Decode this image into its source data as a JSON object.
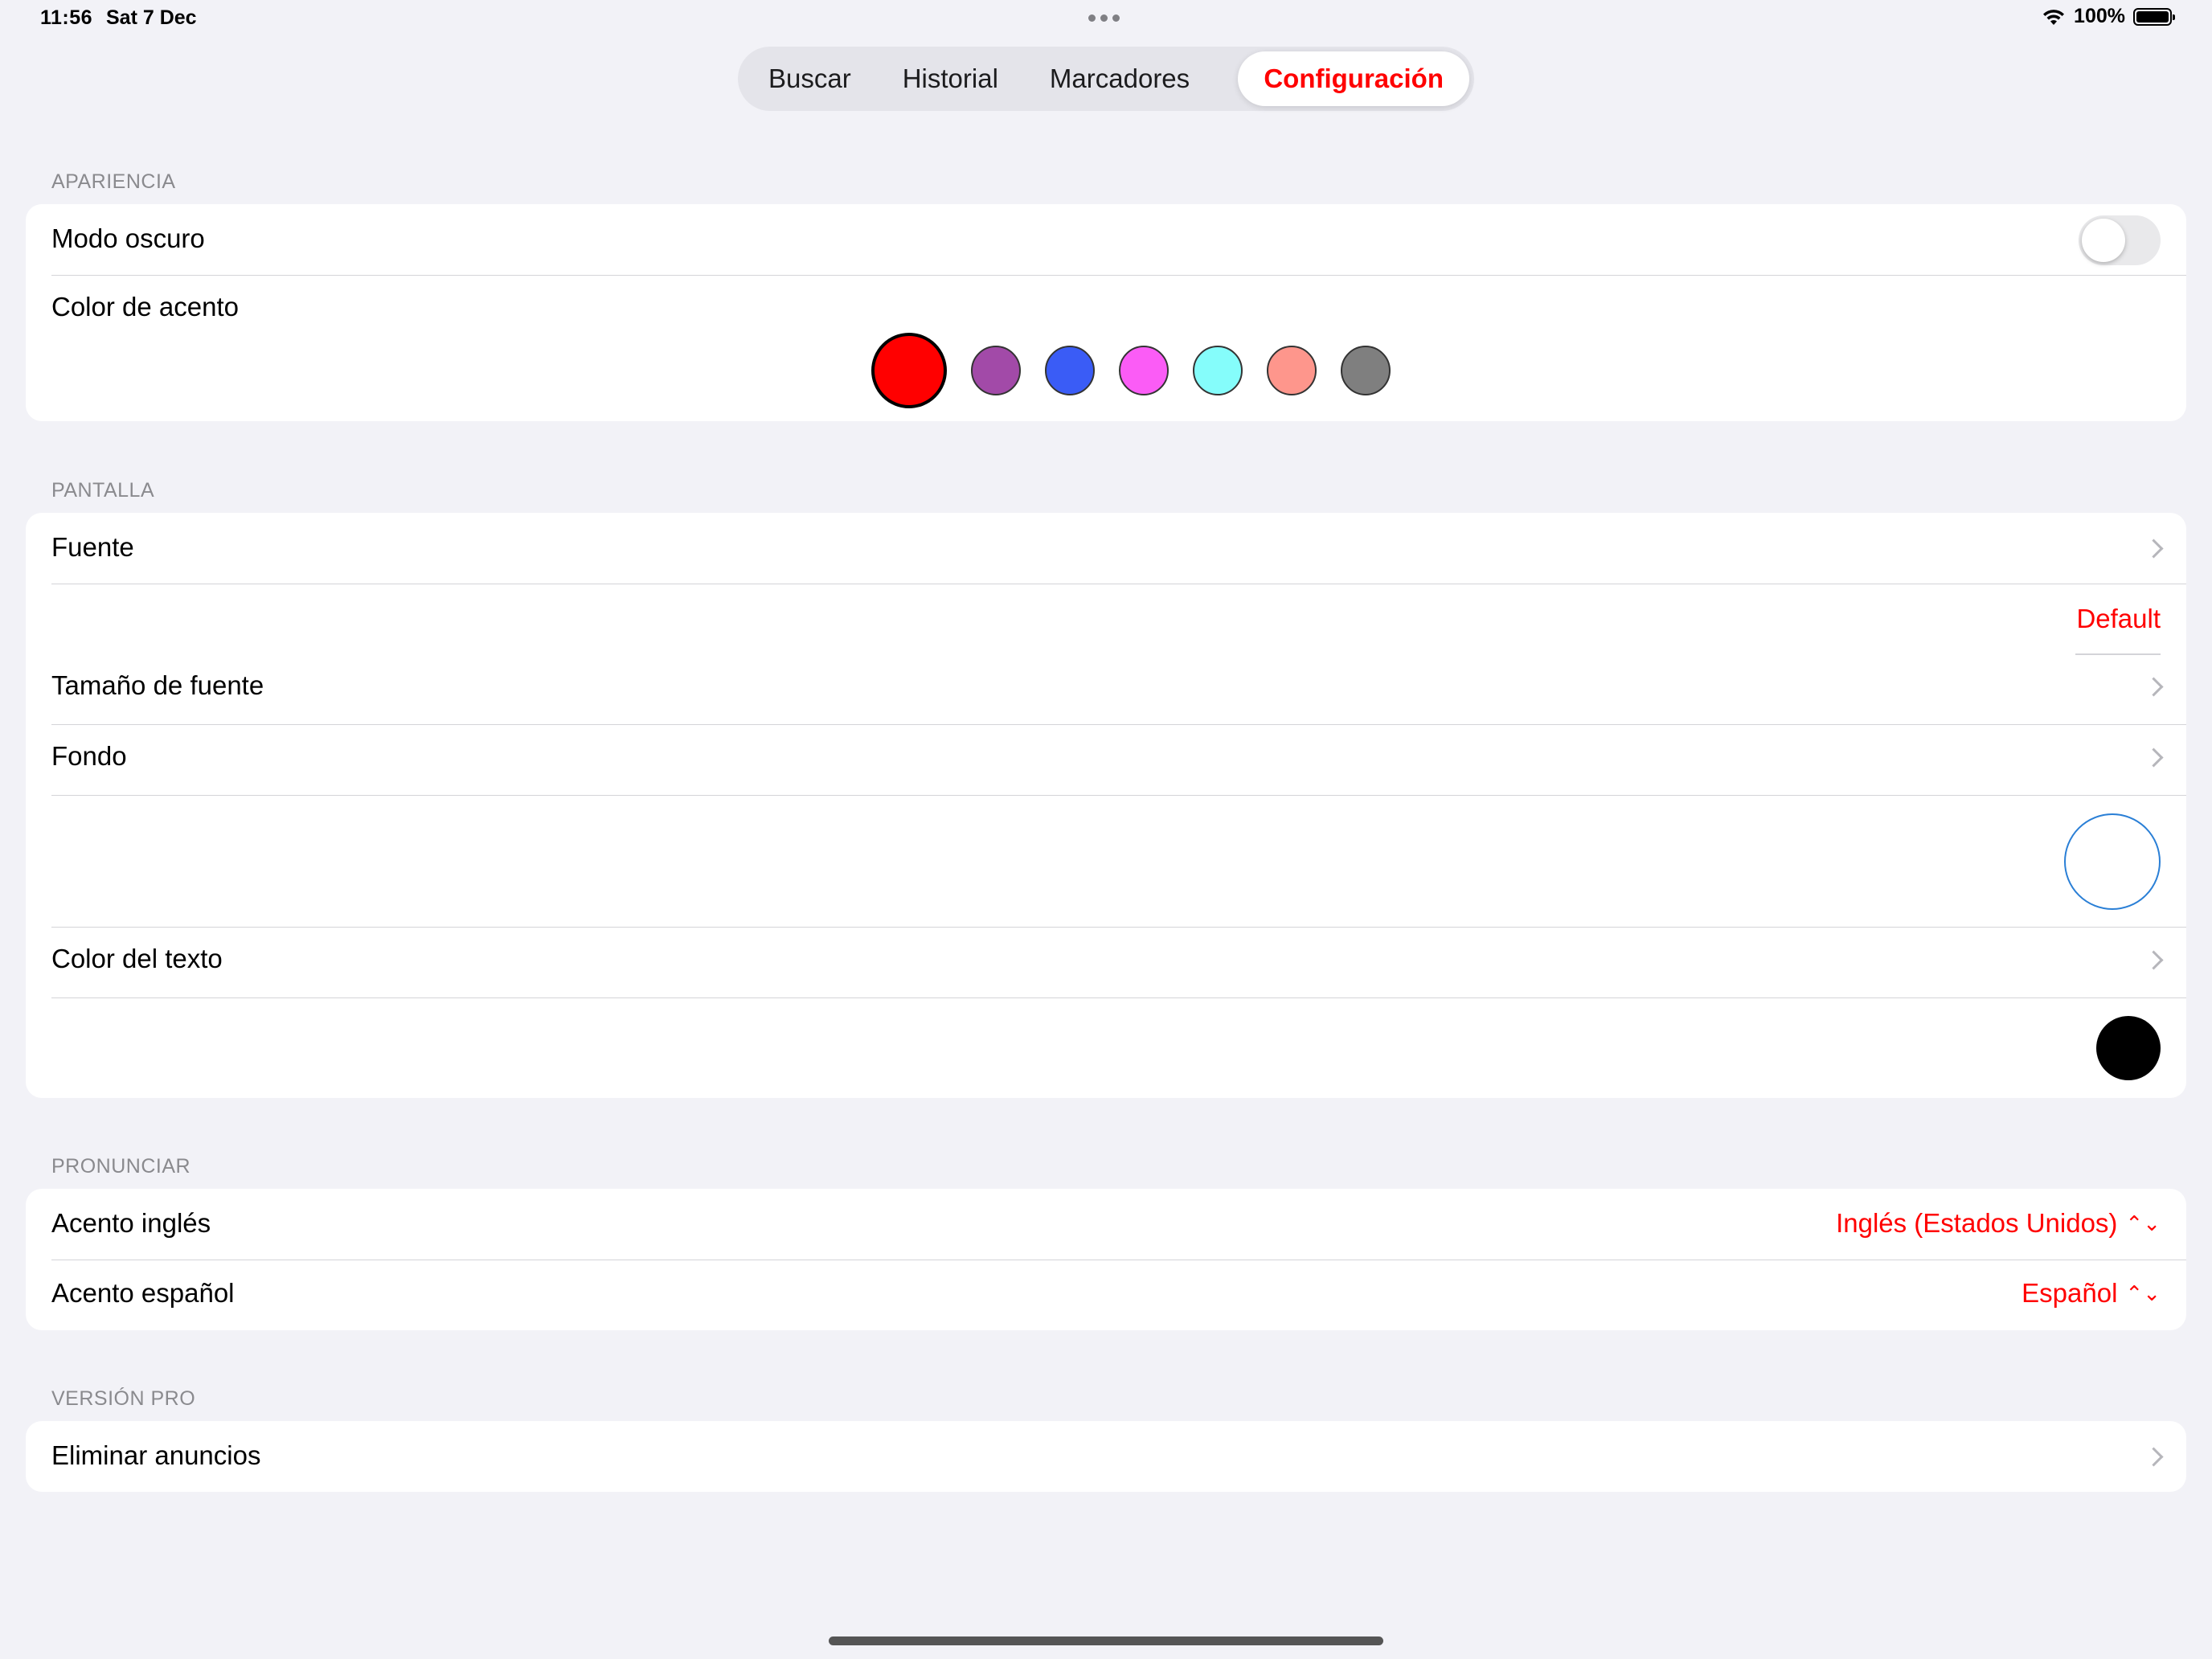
{
  "status_bar": {
    "time": "11:56",
    "date": "Sat 7 Dec",
    "battery": "100%"
  },
  "tabs": [
    {
      "label": "Buscar"
    },
    {
      "label": "Historial"
    },
    {
      "label": "Marcadores"
    },
    {
      "label": "Configuración",
      "active": true
    }
  ],
  "apariencia": {
    "header": "APARIENCIA",
    "dark_mode_label": "Modo oscuro",
    "dark_mode_on": false,
    "accent_label": "Color de acento",
    "accent_colors": [
      "#ff0000",
      "#a24aa8",
      "#3a5cf6",
      "#fb5cf6",
      "#85fdfb",
      "#fe968c",
      "#7f7f7f"
    ],
    "accent_selected_index": 0
  },
  "pantalla": {
    "header": "PANTALLA",
    "font_label": "Fuente",
    "font_value": "Default",
    "font_size_label": "Tamaño de fuente",
    "background_label": "Fondo",
    "background_color": "#ffffff",
    "text_color_label": "Color del texto",
    "text_color": "#000000"
  },
  "pronunciar": {
    "header": "PRONUNCIAR",
    "english_label": "Acento inglés",
    "english_value": "Inglés (Estados Unidos)",
    "spanish_label": "Acento español",
    "spanish_value": "Español"
  },
  "pro": {
    "header": "VERSIÓN PRO",
    "remove_ads_label": "Eliminar anuncios"
  },
  "theme": {
    "accent": "#ff0000",
    "background": "#f2f2f7"
  }
}
